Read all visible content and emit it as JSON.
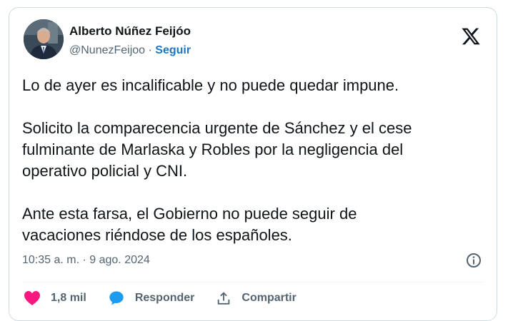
{
  "author": {
    "display_name": "Alberto Núñez Feijóo",
    "handle": "@NunezFeijoo",
    "separator": " · ",
    "follow_label": "Seguir"
  },
  "tweet": {
    "paragraph_1": "Lo de ayer es incalificable y no puede quedar impune.",
    "paragraph_2_line_1": "Solicito la comparecencia urgente de Sánchez y el cese",
    "paragraph_2_line_2": "fulminante de Marlaska y Robles por la negligencia del",
    "paragraph_2_line_3": "operativo policial y CNI.",
    "paragraph_3_line_1": "Ante esta farsa, el Gobierno no puede seguir de",
    "paragraph_3_line_2": "vacaciones riéndose de los españoles.",
    "timestamp": "10:35 a. m. · 9 ago. 2024"
  },
  "actions": {
    "like_count": "1,8 mil",
    "reply_label": "Responder",
    "share_label": "Compartir"
  },
  "colors": {
    "link_blue": "#1d76bf",
    "like_pink": "#f91880",
    "reply_blue": "#1d9bf0",
    "secondary_text": "#536471",
    "border": "#cfd9de"
  },
  "icons": {
    "brand": "x-logo-icon",
    "info": "info-icon",
    "like": "heart-icon",
    "reply": "speech-bubble-icon",
    "share": "share-upload-icon"
  }
}
